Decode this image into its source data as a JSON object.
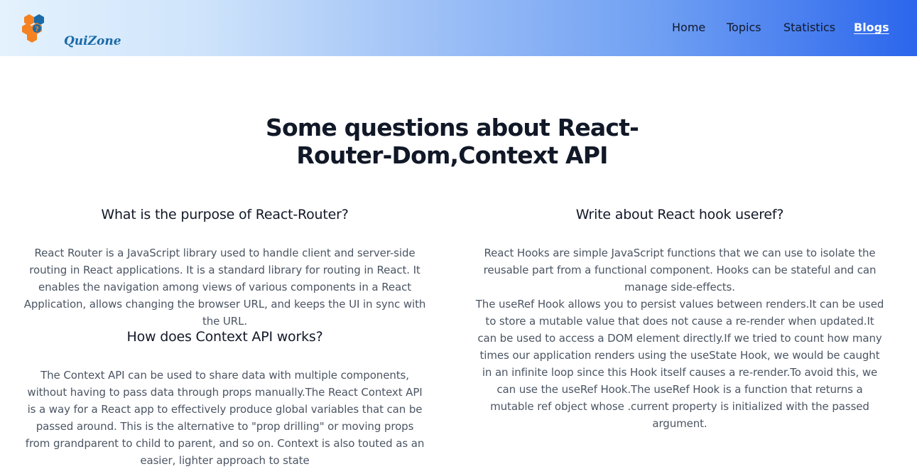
{
  "header": {
    "logo_text": "QuiZone",
    "nav": [
      {
        "label": "Home",
        "active": false
      },
      {
        "label": "Topics",
        "active": false
      },
      {
        "label": "Statistics",
        "active": false
      },
      {
        "label": "Blogs",
        "active": true
      }
    ],
    "gradient_colors": [
      "#e4f2fd",
      "#2b66ec"
    ]
  },
  "main": {
    "title": "Some questions about React-Router-Dom,Context API",
    "qa": [
      {
        "question": "What is the purpose of React-Router?",
        "answer": "React Router is a JavaScript library used to handle client and server-side routing in React applications. It is a standard library for routing in React. It enables the navigation among views of various components in a React Application, allows changing the browser URL, and keeps the UI in sync with the URL."
      },
      {
        "question": "How does Context API works?",
        "answer": "The Context API can be used to share data with multiple components, without having to pass data through props manually.The React Context API is a way for a React app to effectively produce global variables that can be passed around. This is the alternative to \"prop drilling\" or moving props from grandparent to child to parent, and so on. Context is also touted as an easier, lighter approach to state"
      },
      {
        "question": "Write about React hook useref?",
        "answer_intro": "React Hooks are simple JavaScript functions that we can use to isolate the reusable part from a functional component. Hooks can be stateful and can manage side-effects.",
        "answer_body": "The useRef Hook allows you to persist values between renders.It can be used to store a mutable value that does not cause a re-render when updated.It can be used to access a DOM element directly.If we tried to count how many times our application renders using the useState Hook, we would be caught in an infinite loop since this Hook itself causes a re-render.To avoid this, we can use the useRef Hook.The useRef Hook is a function that returns a mutable ref object whose .current property is initialized with the passed argument."
      }
    ]
  }
}
